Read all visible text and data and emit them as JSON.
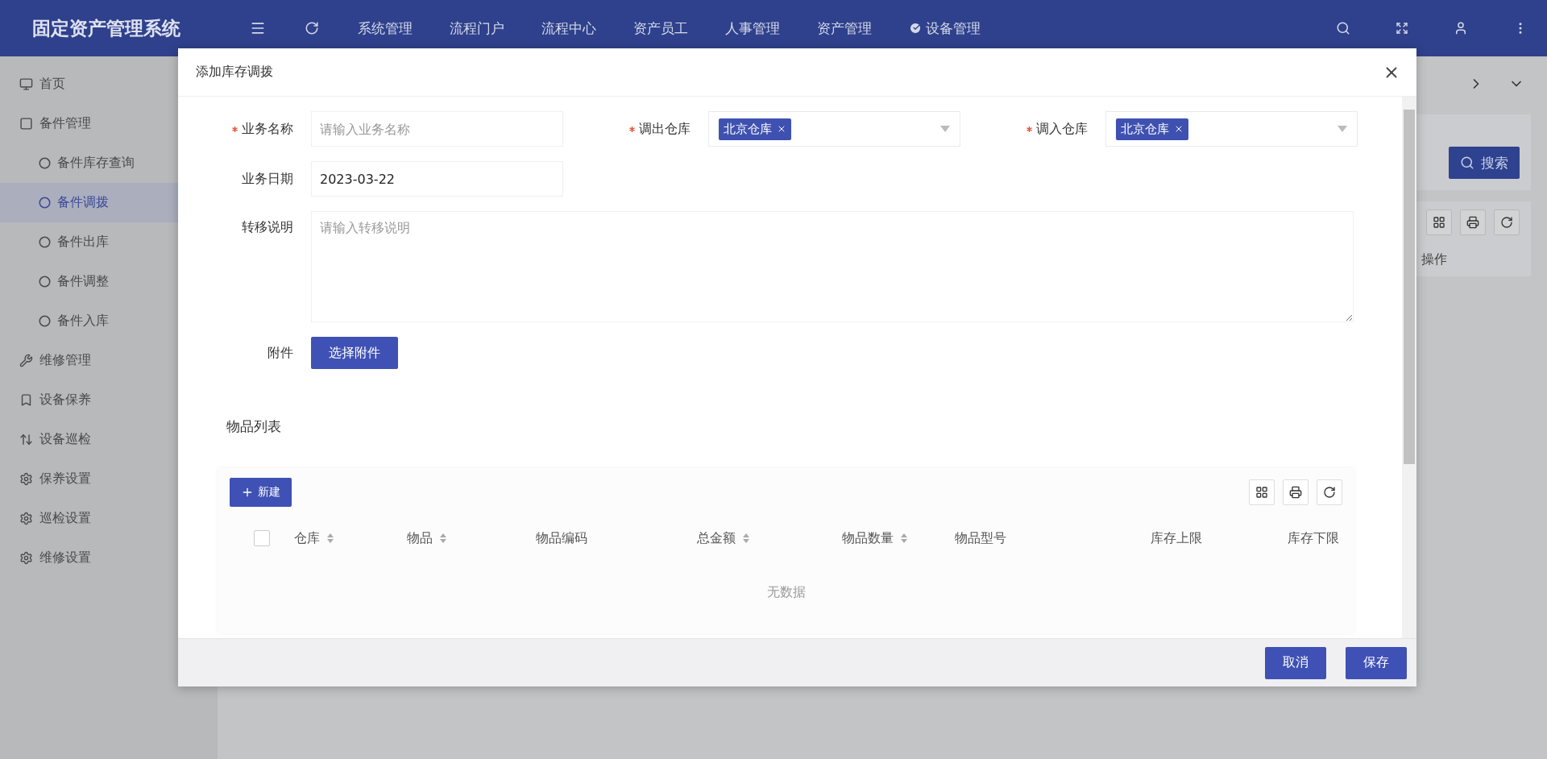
{
  "header": {
    "title": "固定资产管理系统",
    "menu": [
      {
        "label": "系统管理",
        "kind": "plain"
      },
      {
        "label": "流程门户",
        "kind": "plain"
      },
      {
        "label": "流程中心",
        "kind": "plain"
      },
      {
        "label": "资产员工",
        "kind": "plain"
      },
      {
        "label": "人事管理",
        "kind": "plain"
      },
      {
        "label": "资产管理",
        "kind": "plain"
      },
      {
        "label": "设备管理",
        "kind": "checked"
      }
    ]
  },
  "sidebar": {
    "items": [
      {
        "label": "首页",
        "selected": false
      },
      {
        "label": "备件管理",
        "selected": false,
        "children": [
          {
            "label": "备件库存查询",
            "selected": false
          },
          {
            "label": "备件调拨",
            "selected": true
          },
          {
            "label": "备件出库",
            "selected": false
          },
          {
            "label": "备件调整",
            "selected": false
          },
          {
            "label": "备件入库",
            "selected": false
          }
        ]
      },
      {
        "label": "维修管理",
        "selected": false
      },
      {
        "label": "设备保养",
        "selected": false
      },
      {
        "label": "设备巡检",
        "selected": false
      },
      {
        "label": "保养设置",
        "selected": false
      },
      {
        "label": "巡检设置",
        "selected": false
      },
      {
        "label": "维修设置",
        "selected": false
      }
    ]
  },
  "background": {
    "search_button": "搜索",
    "table_columns": [
      "操作"
    ]
  },
  "dialog": {
    "title": "添加库存调拨",
    "fields": [
      {
        "kind": "text",
        "label": "业务名称",
        "required": true,
        "placeholder": "请输入业务名称"
      },
      {
        "kind": "select",
        "label": "调出仓库",
        "required": true,
        "tags": [
          "北京仓库"
        ]
      },
      {
        "kind": "select",
        "label": "调入仓库",
        "required": true,
        "tags": [
          "北京仓库"
        ]
      },
      {
        "kind": "text",
        "label": "业务日期",
        "required": false,
        "value": "2023-03-22"
      },
      {
        "kind": "textarea",
        "label": "转移说明",
        "required": false,
        "placeholder": "请输入转移说明"
      },
      {
        "kind": "file",
        "label": "附件",
        "required": false,
        "button": "选择附件"
      }
    ],
    "items": {
      "title": "物品列表",
      "new_button": "新建",
      "select_all": {
        "checked": false
      },
      "columns": [
        {
          "label": "仓库",
          "sortable": true
        },
        {
          "label": "物品",
          "sortable": true
        },
        {
          "label": "物品编码",
          "sortable": false
        },
        {
          "label": "总金额",
          "sortable": true
        },
        {
          "label": "物品数量",
          "sortable": true
        },
        {
          "label": "物品型号",
          "sortable": false
        },
        {
          "label": "库存上限",
          "sortable": false
        },
        {
          "label": "库存下限",
          "sortable": false
        }
      ],
      "empty_text": "无数据"
    },
    "buttons": [
      "取消",
      "保存"
    ]
  }
}
